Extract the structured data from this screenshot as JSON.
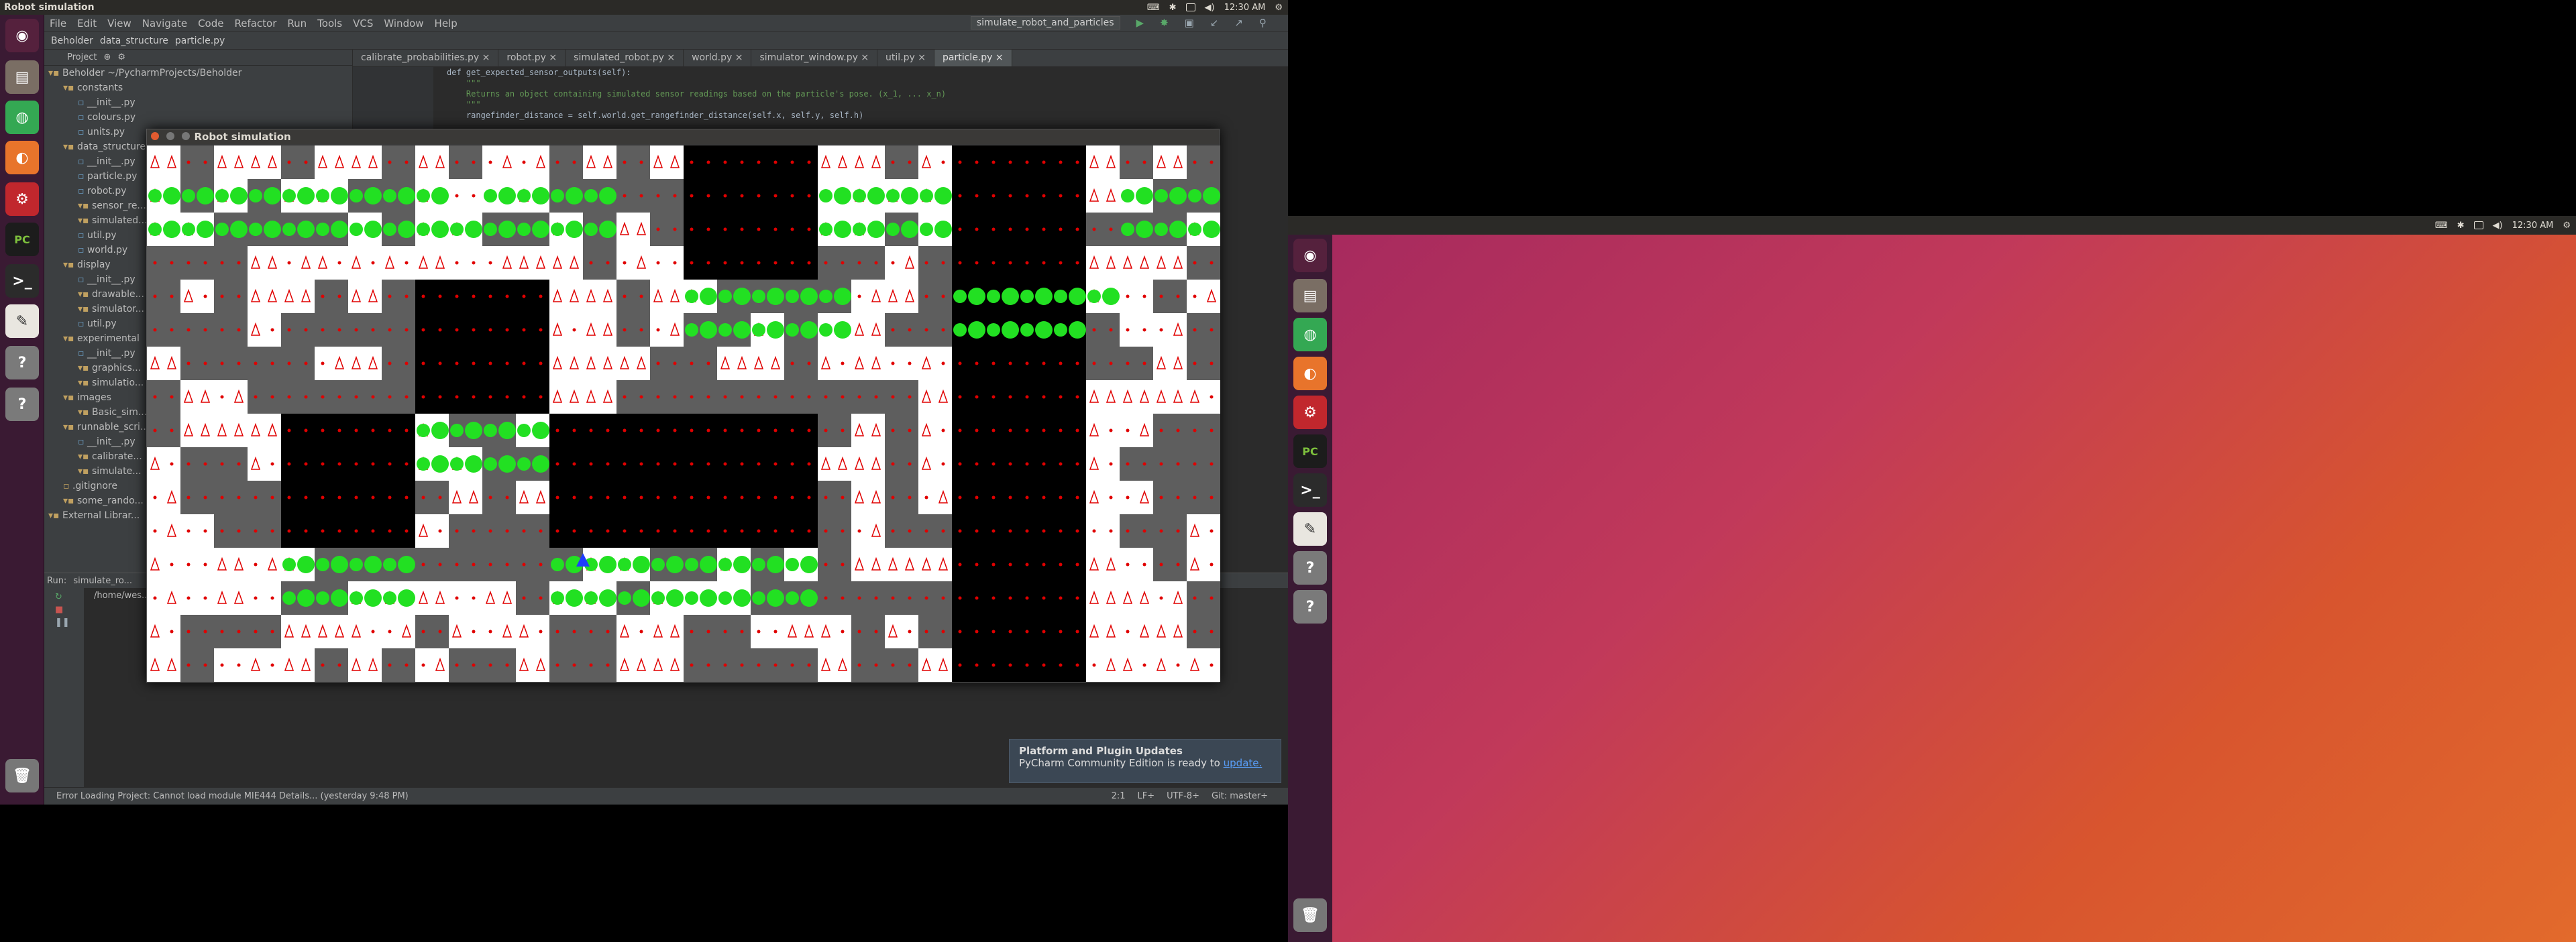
{
  "left": {
    "topbar": {
      "title": "Robot simulation",
      "time": "12:30 AM"
    },
    "menu": [
      "File",
      "Edit",
      "View",
      "Navigate",
      "Code",
      "Refactor",
      "Run",
      "Tools",
      "VCS",
      "Window",
      "Help"
    ],
    "run_config": "simulate_robot_and_particles",
    "navbar": [
      "Beholder",
      "data_structure",
      "particle.py"
    ],
    "project_header": "Project",
    "tree": [
      {
        "label": "Beholder ~/PycharmProjects/Beholder",
        "indent": 0
      },
      {
        "label": "constants",
        "indent": 1
      },
      {
        "label": "__init__.py",
        "indent": 2
      },
      {
        "label": "colours.py",
        "indent": 2
      },
      {
        "label": "units.py",
        "indent": 2
      },
      {
        "label": "data_structure",
        "indent": 1
      },
      {
        "label": "__init__.py",
        "indent": 2
      },
      {
        "label": "particle.py",
        "indent": 2
      },
      {
        "label": "robot.py",
        "indent": 2
      },
      {
        "label": "sensor_re...",
        "indent": 2
      },
      {
        "label": "simulated...",
        "indent": 2
      },
      {
        "label": "util.py",
        "indent": 2
      },
      {
        "label": "world.py",
        "indent": 2
      },
      {
        "label": "display",
        "indent": 1
      },
      {
        "label": "__init__.py",
        "indent": 2
      },
      {
        "label": "drawable...",
        "indent": 2
      },
      {
        "label": "simulator...",
        "indent": 2
      },
      {
        "label": "util.py",
        "indent": 2
      },
      {
        "label": "experimental",
        "indent": 1
      },
      {
        "label": "__init__.py",
        "indent": 2
      },
      {
        "label": "graphics...",
        "indent": 2
      },
      {
        "label": "simulatio...",
        "indent": 2
      },
      {
        "label": "images",
        "indent": 1
      },
      {
        "label": "Basic_sim...",
        "indent": 2
      },
      {
        "label": "runnable_scri...",
        "indent": 1
      },
      {
        "label": "__init__.py",
        "indent": 2
      },
      {
        "label": "calibrate...",
        "indent": 2
      },
      {
        "label": "simulate...",
        "indent": 2
      },
      {
        "label": ".gitignore",
        "indent": 1
      },
      {
        "label": "some_rando...",
        "indent": 1
      },
      {
        "label": "External Librar...",
        "indent": 0
      }
    ],
    "tabs": [
      "calibrate_probabilities.py",
      "robot.py",
      "simulated_robot.py",
      "world.py",
      "simulator_window.py",
      "util.py",
      "particle.py"
    ],
    "code": [
      "def get_expected_sensor_outputs(self):",
      "    \"\"\"",
      "    Returns an object containing simulated sensor readings based on the particle's pose. (x_1, ... x_n)",
      "    \"\"\"",
      "    rangefinder_distance = self.world.get_rangefinder_distance(self.x, self.y, self.h)"
    ],
    "run_label": "Run:",
    "run_tab": "simulate_ro...",
    "run_output": "/home/wes...",
    "status": "Error Loading Project: Cannot load module MIE444 Details... (yesterday 9:48 PM)",
    "status_right": [
      "2:1",
      "LF÷",
      "UTF-8÷",
      "Git: master÷"
    ],
    "notification": {
      "title": "Platform and Plugin Updates",
      "body": "PyCharm Community Edition is ready to ",
      "link": "update."
    },
    "sim_title": "Robot simulation"
  },
  "right": {
    "time": "12:30 AM"
  },
  "colors": {
    "ide_bg": "#3c3f41",
    "editor_bg": "#2b2b2b",
    "launcher": "#3a1a33",
    "accent_green": "#22e022",
    "particle_red": "#e00000",
    "wall_gray": "#5e5e5e"
  }
}
